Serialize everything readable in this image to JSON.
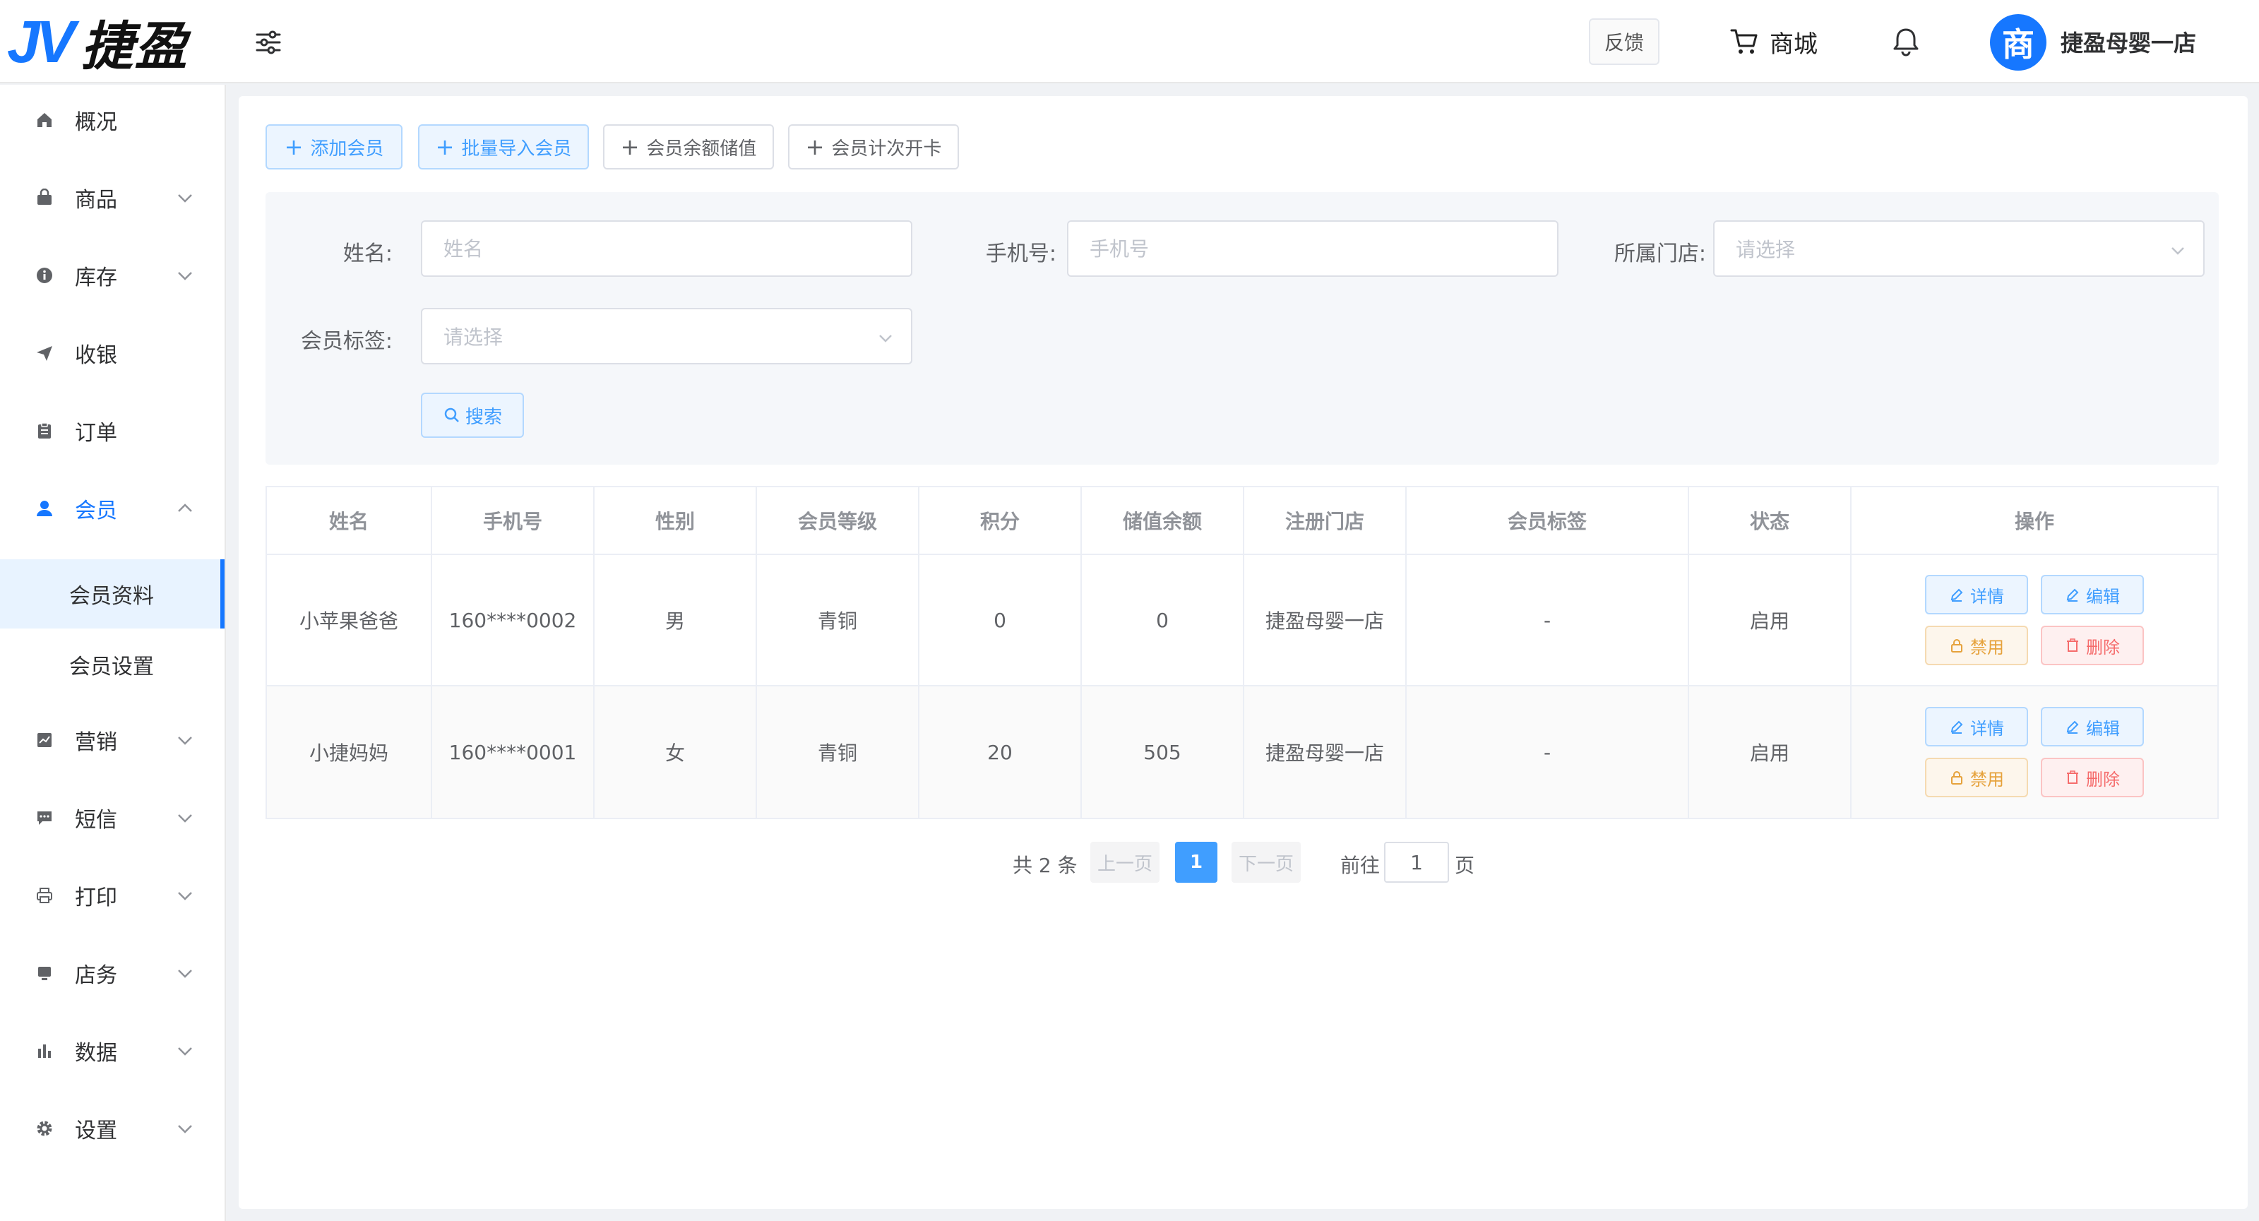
{
  "header": {
    "logo_mark": "JV",
    "logo_text": "捷盈",
    "feedback": "反馈",
    "mall": "商城",
    "avatar_char": "商",
    "store_name": "捷盈母婴一店"
  },
  "sidebar": {
    "items": [
      {
        "label": "概况",
        "icon": "home-icon"
      },
      {
        "label": "商品",
        "icon": "bag-icon"
      },
      {
        "label": "库存",
        "icon": "info-icon"
      },
      {
        "label": "收银",
        "icon": "send-icon"
      },
      {
        "label": "订单",
        "icon": "clipboard-icon"
      },
      {
        "label": "会员",
        "icon": "user-icon"
      },
      {
        "label": "营销",
        "icon": "chart-icon"
      },
      {
        "label": "短信",
        "icon": "message-icon"
      },
      {
        "label": "打印",
        "icon": "printer-icon"
      },
      {
        "label": "店务",
        "icon": "shop-icon"
      },
      {
        "label": "数据",
        "icon": "bar-chart-icon"
      },
      {
        "label": "设置",
        "icon": "gear-icon"
      }
    ],
    "member_sub": [
      "会员资料",
      "会员设置"
    ]
  },
  "toolbar": {
    "add_member": "添加会员",
    "batch_import": "批量导入会员",
    "balance_deposit": "会员余额储值",
    "count_card": "会员计次开卡"
  },
  "filter": {
    "name_label": "姓名:",
    "name_placeholder": "姓名",
    "phone_label": "手机号:",
    "phone_placeholder": "手机号",
    "store_label": "所属门店:",
    "store_placeholder": "请选择",
    "tag_label": "会员标签:",
    "tag_placeholder": "请选择",
    "search": "搜索"
  },
  "table": {
    "headers": [
      "姓名",
      "手机号",
      "性别",
      "会员等级",
      "积分",
      "储值余额",
      "注册门店",
      "会员标签",
      "状态",
      "操作"
    ],
    "rows": [
      {
        "name": "小苹果爸爸",
        "phone": "160****0002",
        "gender": "男",
        "level": "青铜",
        "points": "0",
        "balance": "0",
        "store": "捷盈母婴一店",
        "tag": "-",
        "status": "启用"
      },
      {
        "name": "小捷妈妈",
        "phone": "160****0001",
        "gender": "女",
        "level": "青铜",
        "points": "20",
        "balance": "505",
        "store": "捷盈母婴一店",
        "tag": "-",
        "status": "启用"
      }
    ],
    "ops": {
      "detail": "详情",
      "edit": "编辑",
      "disable": "禁用",
      "delete": "删除"
    }
  },
  "pagination": {
    "total": "共 2 条",
    "prev": "上一页",
    "current": "1",
    "next": "下一页",
    "goto": "前往",
    "goto_value": "1",
    "page_unit": "页"
  },
  "colors": {
    "primary": "#409eff",
    "brand": "#1677ff",
    "warning": "#e6a23c",
    "danger": "#f56c6c"
  }
}
